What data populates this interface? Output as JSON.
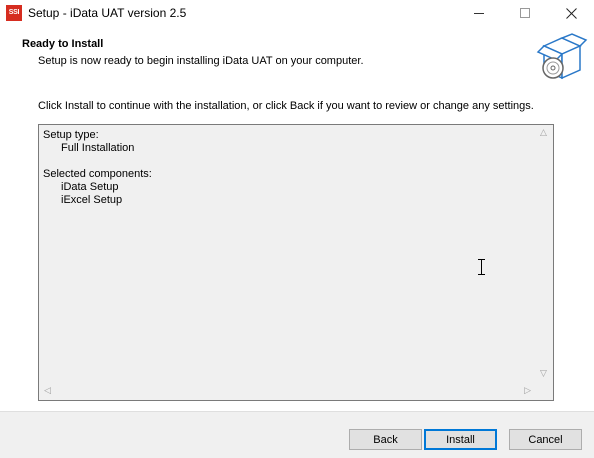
{
  "window": {
    "title": "Setup - iData UAT version 2.5",
    "app_icon_text": "SSI",
    "controls": [
      "minimize-icon",
      "maximize-icon",
      "close-icon"
    ]
  },
  "header": {
    "title": "Ready to Install",
    "subtitle": "Setup is now ready to begin installing iData UAT on your computer.",
    "icon": "install-box-icon"
  },
  "instruction": "Click Install to continue with the installation, or click Back if you want to review or change any settings.",
  "memo": {
    "setup_type_label": "Setup type:",
    "setup_type_value": "Full Installation",
    "components_label": "Selected components:",
    "components": [
      "iData Setup",
      "iExcel Setup"
    ]
  },
  "buttons": {
    "back": "Back",
    "install": "Install",
    "cancel": "Cancel"
  },
  "colors": {
    "default_button_border": "#0078d7",
    "memo_background": "#f0f0f0",
    "footer_background": "#f0f0f0"
  }
}
